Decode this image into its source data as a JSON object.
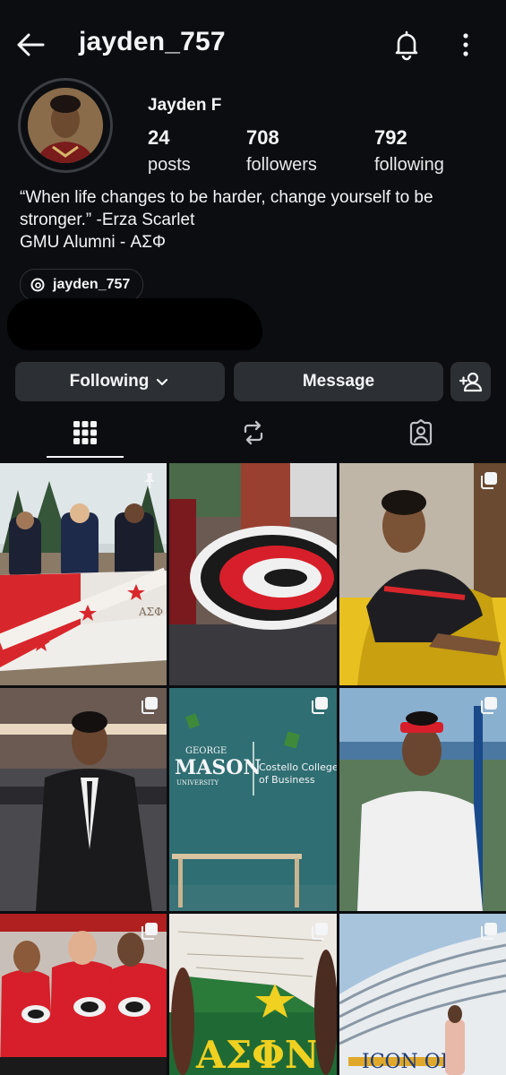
{
  "header": {
    "username": "jayden_757",
    "back_icon": "arrow-left-icon",
    "bell_icon": "bell-icon",
    "more_icon": "more-vertical-icon"
  },
  "profile": {
    "display_name": "Jayden F",
    "stats": [
      {
        "value": "24",
        "label": "posts"
      },
      {
        "value": "708",
        "label": "followers"
      },
      {
        "value": "792",
        "label": "following"
      }
    ],
    "bio": [
      "“When life changes to be harder, change yourself to be",
      "stronger.” -Erza Scarlet",
      "GMU Alumni - ΑΣΦ"
    ],
    "threads_handle": "jayden_757"
  },
  "actions": {
    "following_label": "Following",
    "message_label": "Message",
    "add_person_icon": "person-add-icon"
  },
  "tabs": [
    {
      "icon": "grid-icon",
      "active": true
    },
    {
      "icon": "repost-icon",
      "active": false
    },
    {
      "icon": "tagged-icon",
      "active": false
    }
  ],
  "posts": [
    {
      "label": "Group photo with flag",
      "badge": "pin-icon"
    },
    {
      "label": "Carolina Hurricanes logo",
      "badge": ""
    },
    {
      "label": "Relaxing on yellow couch",
      "badge": "multi-photo-icon"
    },
    {
      "label": "Suit portrait",
      "badge": "multi-photo-icon"
    },
    {
      "label": "George Mason wall",
      "badge": "multi-photo-icon",
      "text_george": "GEORGE",
      "text_mason": "MASON",
      "text_university": "UNIVERSITY",
      "text_college": "Costello College",
      "text_business": "of Business"
    },
    {
      "label": "Red headband outdoors",
      "badge": "multi-photo-icon"
    },
    {
      "label": "Hurricanes jerseys",
      "badge": "multi-photo-icon"
    },
    {
      "label": "ASPhi banner",
      "badge": "multi-photo-icon",
      "text_banner": "AΣΦN"
    },
    {
      "label": "Cruise ship",
      "badge": "multi-photo-icon",
      "text_ship": "ICON OF"
    }
  ],
  "colors": {
    "background": "#0b0d10",
    "button": "#2c2f34",
    "text": "#f4f5f7"
  }
}
